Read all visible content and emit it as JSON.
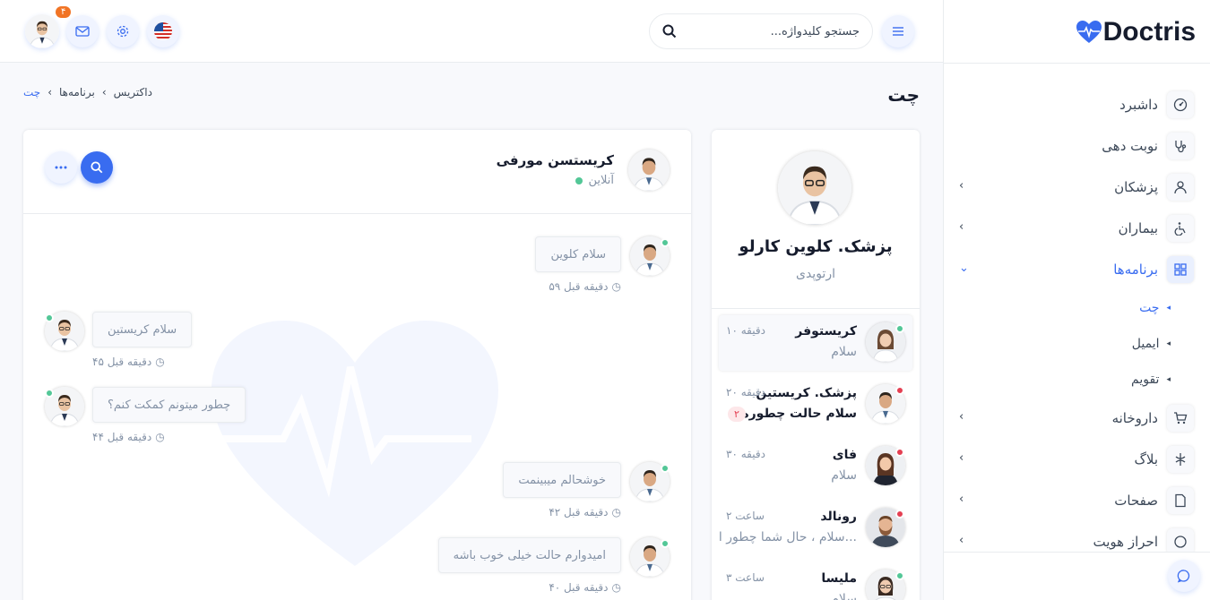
{
  "brand": {
    "name": "Doctris",
    "heart_color": "#396cf0"
  },
  "colors": {
    "primary": "#396cf0",
    "online": "#53c797",
    "away": "#e43f52",
    "badge": "#f17425"
  },
  "sidebar": {
    "items": [
      {
        "label": "داشبرد",
        "icon": "dashboard-icon",
        "has_chevron": false
      },
      {
        "label": "نوبت دهی",
        "icon": "stethoscope-icon",
        "has_chevron": false
      },
      {
        "label": "پزشکان",
        "icon": "user-icon",
        "has_chevron": true
      },
      {
        "label": "بیماران",
        "icon": "wheelchair-icon",
        "has_chevron": true
      },
      {
        "label": "برنامه‌ها",
        "icon": "apps-grid-icon",
        "has_chevron": true,
        "expanded": true,
        "active": true
      },
      {
        "label": "داروخانه",
        "icon": "cart-icon",
        "has_chevron": true
      },
      {
        "label": "بلاگ",
        "icon": "flower-icon",
        "has_chevron": true
      },
      {
        "label": "صفحات",
        "icon": "file-icon",
        "has_chevron": true
      },
      {
        "label": "احراز هویت",
        "icon": "login-icon",
        "has_chevron": true
      }
    ],
    "subitems": [
      {
        "label": "چت",
        "active": true
      },
      {
        "label": "ایمیل",
        "active": false
      },
      {
        "label": "تقویم",
        "active": false
      }
    ]
  },
  "topbar": {
    "search_placeholder": "جستجو کلیدواژه...",
    "notification_count": "۴",
    "menu_icon": "hamburger-icon",
    "language_flag": "us-flag-icon"
  },
  "page": {
    "title": "چت",
    "breadcrumb": [
      "داکتریس",
      "برنامه‌ها",
      "چت"
    ]
  },
  "profile": {
    "name": "پزشک. کلوین کارلو",
    "role": "ارتوپدی"
  },
  "conversations": [
    {
      "name": "کریستوفر",
      "message": "سلام",
      "time": "۱۰ دقیقه",
      "status": "online",
      "selected": true,
      "avatar": "female"
    },
    {
      "name": "پزشک. کریستین",
      "message": "سلام حالت چطوره؟",
      "time": "۲۰ دقیقه",
      "status": "away",
      "unread": "۲",
      "bold": true,
      "avatar": "male-doctor"
    },
    {
      "name": "فای",
      "message": "سلام",
      "time": "۳۰ دقیقه",
      "status": "away",
      "avatar": "female-dark"
    },
    {
      "name": "رونالد",
      "message": "سلام ، حال شما چطور ا...",
      "time": "۲ ساعت",
      "status": "away",
      "avatar": "male-beard"
    },
    {
      "name": "ملیسا",
      "message": "سلام",
      "time": "۳ ساعت",
      "status": "online",
      "avatar": "female-doctor"
    }
  ],
  "chat": {
    "contact_name": "کریستسن مورفی",
    "contact_status": "آنلاین",
    "messages": [
      {
        "text": "سلام کلوین",
        "time": "۵۹ دقیقه قبل",
        "dir": "in"
      },
      {
        "text": "سلام کریستین",
        "time": "۴۵ دقیقه قبل",
        "dir": "out"
      },
      {
        "text": "چطور میتونم کمکت کنم؟",
        "time": "۴۴ دقیقه قبل",
        "dir": "out"
      },
      {
        "text": "خوشحالم میبینمت",
        "time": "۴۲ دقیقه قبل",
        "dir": "in"
      },
      {
        "text": "امیدوارم حالت خیلی خوب باشه",
        "time": "۴۰ دقیقه قبل",
        "dir": "in"
      }
    ]
  }
}
